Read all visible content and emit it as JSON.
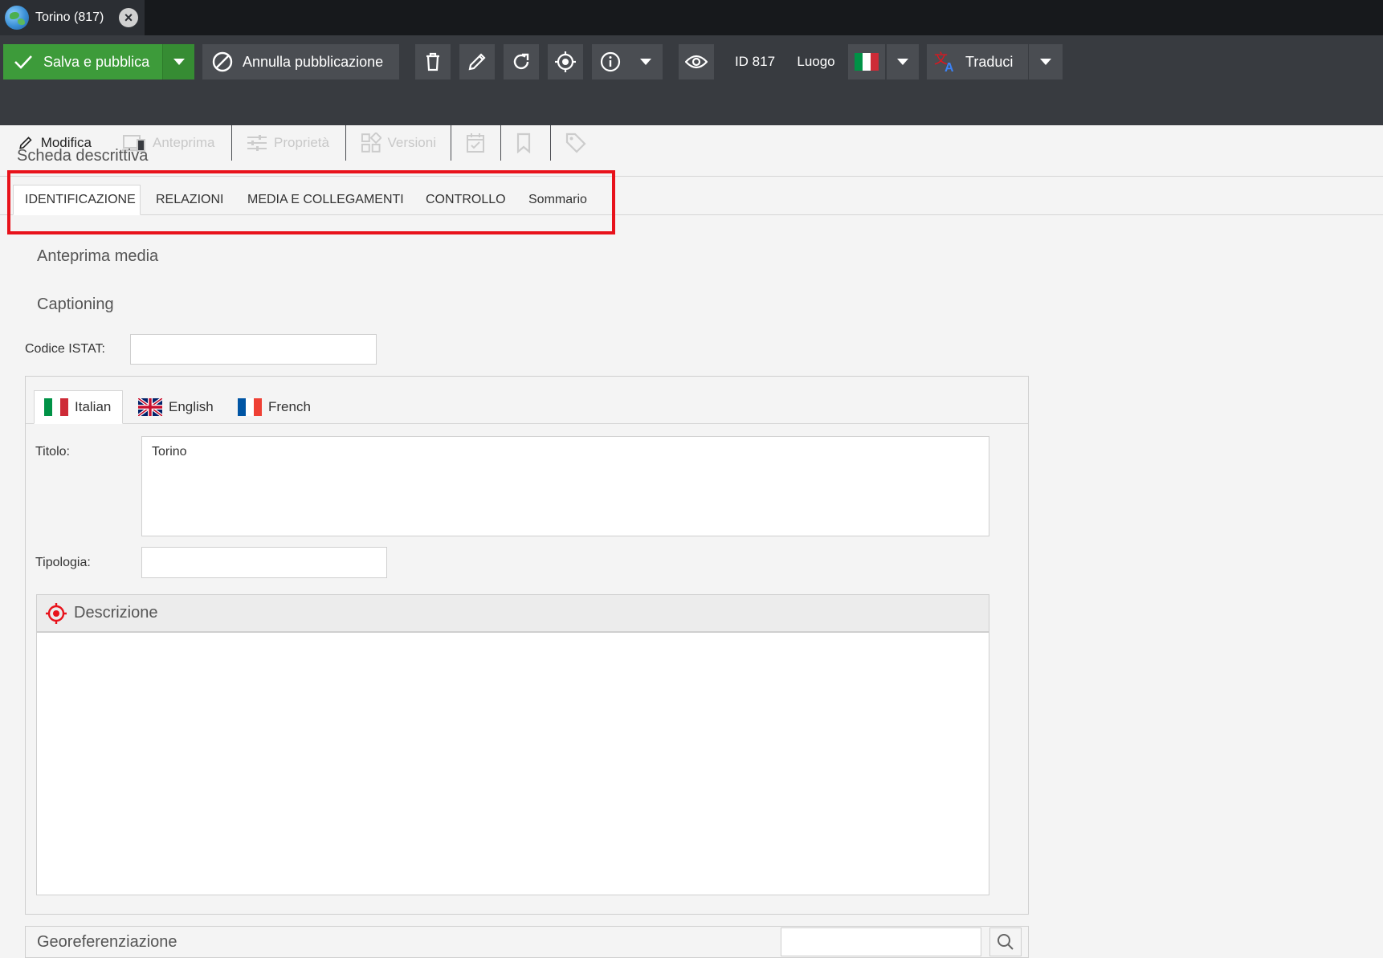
{
  "window": {
    "tab_title": "Torino (817)"
  },
  "toolbar": {
    "save_label": "Salva e pubblica",
    "unpublish_label": "Annulla pubblicazione",
    "id_label": "ID 817",
    "type_label": "Luogo",
    "translate_label": "Traduci",
    "icons": [
      "check-icon",
      "ban-icon",
      "trash-icon",
      "pencil-icon",
      "refresh-icon",
      "target-icon",
      "info-icon",
      "eye-icon",
      "flag-it-icon",
      "translate-icon"
    ]
  },
  "subtabs": [
    {
      "label": "Modifica"
    },
    {
      "label": "Anteprima"
    },
    {
      "label": "Proprietà"
    },
    {
      "label": "Versioni"
    }
  ],
  "main": {
    "section_title": "Scheda descrittiva",
    "tabs": [
      {
        "label": "IDENTIFICAZIONE"
      },
      {
        "label": "RELAZIONI"
      },
      {
        "label": "MEDIA E COLLEGAMENTI"
      },
      {
        "label": "CONTROLLO"
      },
      {
        "label": "Sommario"
      }
    ],
    "media_preview_label": "Anteprima media",
    "captioning_label": "Captioning",
    "istat_label": "Codice ISTAT:",
    "istat_value": "",
    "lang_tabs": [
      {
        "label": "Italian"
      },
      {
        "label": "English"
      },
      {
        "label": "French"
      }
    ],
    "title_label": "Titolo:",
    "title_value": "Torino",
    "type_field_label": "Tipologia:",
    "type_field_value": "",
    "description_label": "Descrizione",
    "geo_label": "Georeferenziazione"
  },
  "colors": {
    "highlight": "#e8121b",
    "save_green": "#3d9b3a",
    "toolbar_bg": "#383b40"
  }
}
